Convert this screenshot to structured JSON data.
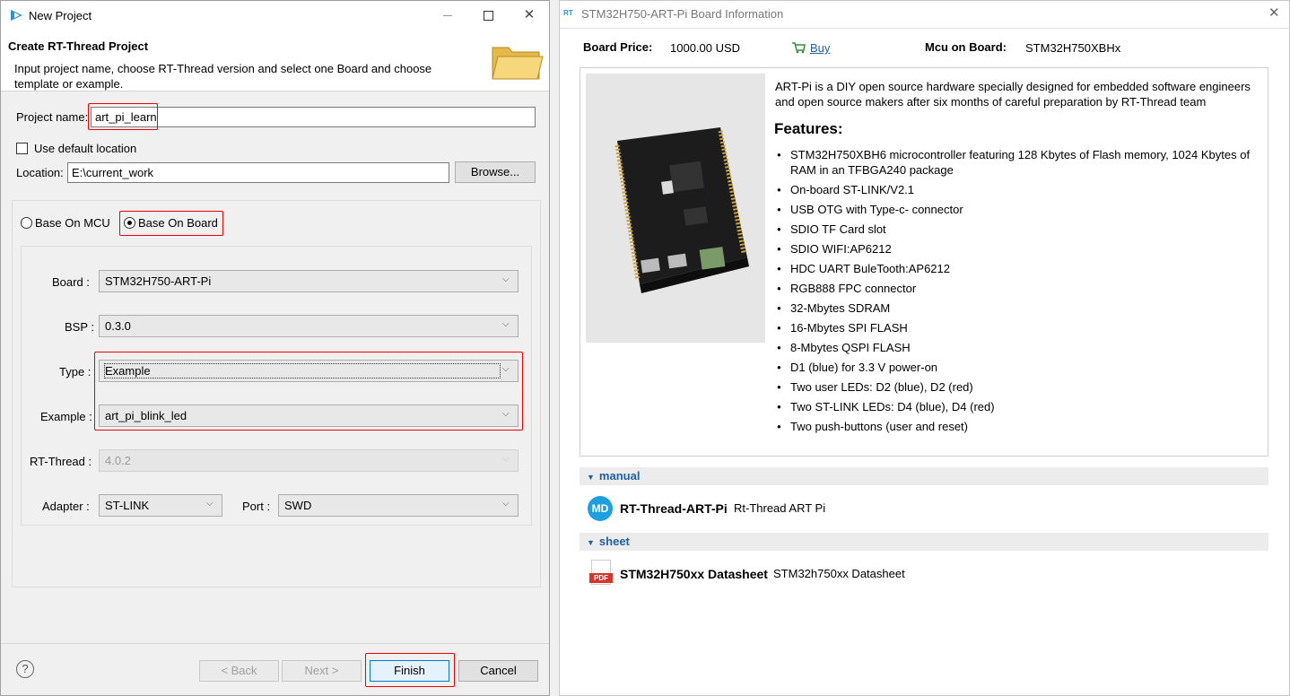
{
  "dialog": {
    "title": "New Project",
    "header_title": "Create RT-Thread Project",
    "header_desc": "Input project name, choose RT-Thread version and select one Board and choose template or example.",
    "project_name_label": "Project name:",
    "project_name_value": "art_pi_learn",
    "use_default_label": "Use default location",
    "location_label": "Location:",
    "location_value": "E:\\current_work",
    "browse_label": "Browse...",
    "radio_mcu_label": "Base On MCU",
    "radio_board_label": "Base On Board",
    "board_label": "Board :",
    "board_value": "STM32H750-ART-Pi",
    "bsp_label": "BSP :",
    "bsp_value": "0.3.0",
    "type_label": "Type :",
    "type_value": "Example",
    "example_label": "Example :",
    "example_value": "art_pi_blink_led",
    "rtthread_label": "RT-Thread :",
    "rtthread_value": "4.0.2",
    "adapter_label": "Adapter :",
    "adapter_value": "ST-LINK",
    "port_label": "Port :",
    "port_value": "SWD",
    "back_label": "< Back",
    "next_label": "Next >",
    "finish_label": "Finish",
    "cancel_label": "Cancel",
    "help_icon": "?"
  },
  "info": {
    "title": "STM32H750-ART-Pi Board Information",
    "logo_text": "RT",
    "price_label": "Board Price:",
    "price_value": "1000.00 USD",
    "buy_label": "Buy",
    "mcu_label": "Mcu on Board:",
    "mcu_value": "STM32H750XBHx",
    "intro": "ART-Pi is a DIY open source hardware specially designed for embedded software engineers and open source makers after six months of careful preparation by RT-Thread team",
    "features_title": "Features:",
    "features": [
      "STM32H750XBH6 microcontroller featuring 128 Kbytes of Flash memory, 1024 Kbytes of RAM in an TFBGA240 package",
      "On-board ST-LINK/V2.1",
      "USB OTG with Type-c- connector",
      "SDIO TF Card slot",
      "SDIO WIFI:AP6212",
      "HDC UART BuleTooth:AP6212",
      "RGB888 FPC connector",
      "32-Mbytes SDRAM",
      "16-Mbytes SPI FLASH",
      "8-Mbytes QSPI FLASH",
      "D1 (blue) for 3.3 V power-on",
      "Two user LEDs: D2 (blue), D2 (red)",
      "Two ST-LINK LEDs: D4 (blue), D4 (red)",
      "Two push-buttons (user and reset)"
    ],
    "manual_section": "manual",
    "manual_icon_text": "MD",
    "manual_title": "RT-Thread-ART-Pi",
    "manual_desc": "Rt-Thread ART Pi",
    "sheet_section": "sheet",
    "sheet_icon_text": "PDF",
    "sheet_title": "STM32H750xx Datasheet",
    "sheet_desc": "STM32h750xx Datasheet"
  },
  "colors": {
    "accent_blue": "#1e5fa8",
    "highlight_red": "#e00000",
    "md_icon": "#1ea0e0",
    "pdf_icon": "#d9322b"
  }
}
